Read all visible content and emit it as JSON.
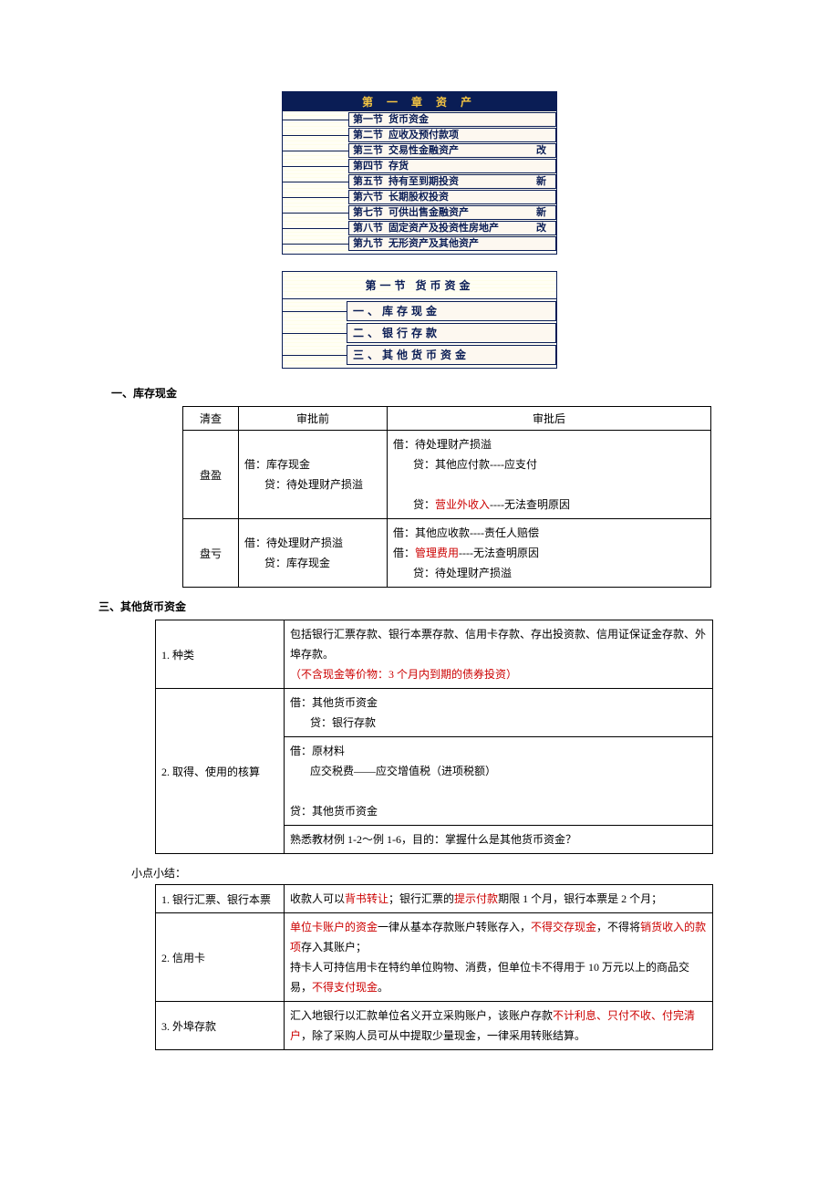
{
  "chapter": {
    "title": "第 一 章  资 产",
    "rows": [
      {
        "num": "第一节",
        "name": "货币资金",
        "tag": ""
      },
      {
        "num": "第二节",
        "name": "应收及预付款项",
        "tag": ""
      },
      {
        "num": "第三节",
        "name": "交易性金融资产",
        "tag": "改"
      },
      {
        "num": "第四节",
        "name": "存货",
        "tag": ""
      },
      {
        "num": "第五节",
        "name": "持有至到期投资",
        "tag": "新"
      },
      {
        "num": "第六节",
        "name": "长期股权投资",
        "tag": ""
      },
      {
        "num": "第七节",
        "name": "可供出售金融资产",
        "tag": "新"
      },
      {
        "num": "第八节",
        "name": "固定资产及投资性房地产",
        "tag": "改"
      },
      {
        "num": "第九节",
        "name": "无形资产及其他资产",
        "tag": ""
      }
    ]
  },
  "section1": {
    "title": "第一节  货币资金",
    "items": [
      "一、库存现金",
      "二、银行存款",
      "三、其他货币资金"
    ]
  },
  "h1": "一、库存现金",
  "t1": {
    "th": [
      "清查",
      "审批前",
      "审批后"
    ],
    "r1": {
      "c1": "盘盈",
      "c2a": "借：库存现金",
      "c2b": "贷：待处理财产损溢",
      "c3a": "借：待处理财产损溢",
      "c3b": "贷：其他应付款----应支付",
      "c3c_pre": "贷：",
      "c3c_red": "营业外收入",
      "c3c_post": "----无法查明原因"
    },
    "r2": {
      "c1": "盘亏",
      "c2a": "借：待处理财产损溢",
      "c2b": "贷：库存现金",
      "c3a": "借：其他应收款----责任人赔偿",
      "c3b_pre": "借：",
      "c3b_red": "管理费用",
      "c3b_post": "----无法查明原因",
      "c3c": "贷：待处理财产损溢"
    }
  },
  "h3": "三、其他货币资金",
  "t2": {
    "r1": {
      "c1": "1. 种类",
      "c2a": "包括银行汇票存款、银行本票存款、信用卡存款、存出投资款、信用证保证金存款、外埠存款。",
      "c2b": "（不含现金等价物：3 个月内到期的债券投资）"
    },
    "r2": {
      "c1": "2. 取得、使用的核算",
      "l1": "借：其他货币资金",
      "l2": "贷：银行存款",
      "l3": "借：原材料",
      "l4": "应交税费——应交增值税（进项税额）",
      "l5": "贷：其他货币资金",
      "l6": "熟悉教材例 1-2～例 1-6，目的：掌握什么是其他货币资金？"
    }
  },
  "note": "小点小结：",
  "t3": {
    "r1": {
      "c1": "1. 银行汇票、银行本票",
      "c2_pre": "收款人可以",
      "c2_red1": "背书转让",
      "c2_mid": "；银行汇票的",
      "c2_red2": "提示付款",
      "c2_post": "期限 1 个月，银行本票是 2 个月；"
    },
    "r2": {
      "c1": "2. 信用卡",
      "l1_red1": "单位卡账户的资金",
      "l1_mid1": "一律从基本存款账户转账存入，",
      "l1_red2": "不得交存现金",
      "l1_mid2": "，不得将",
      "l1_red3": "销货收入的款项",
      "l1_post": "存入其账户；",
      "l2_pre": "持卡人可持信用卡在特约单位购物、消费，但单位卡不得用于 10 万元以上的商品交易，",
      "l2_red": "不得支付现金",
      "l2_post": "。"
    },
    "r3": {
      "c1": "3. 外埠存款",
      "c2_pre": "汇入地银行以汇款单位名义开立采购账户，该账户存款",
      "c2_red": "不计利息、只付不收、付完清户",
      "c2_post": "，除了采购人员可从中提取少量现金，一律采用转账结算。"
    }
  }
}
